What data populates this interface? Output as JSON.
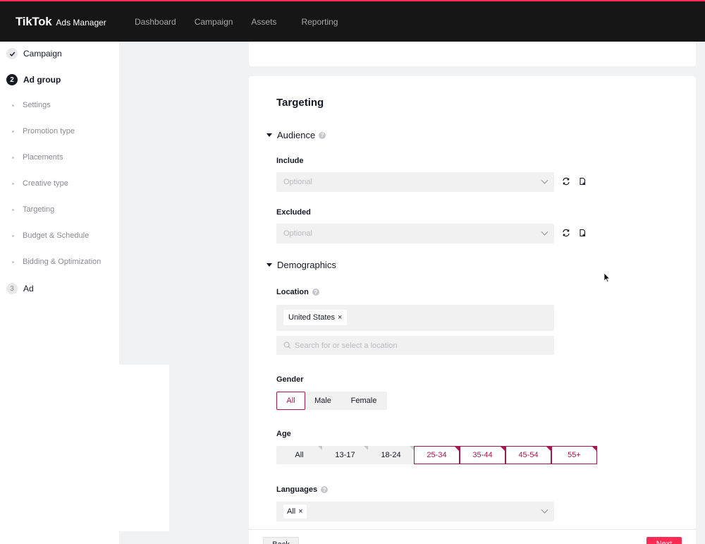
{
  "header": {
    "brand": "TikTok",
    "product": "Ads Manager",
    "nav": [
      "Dashboard",
      "Campaign",
      "Assets",
      "Reporting"
    ]
  },
  "sidebar": {
    "steps": [
      {
        "num": "✓",
        "label": "Campaign"
      },
      {
        "num": "2",
        "label": "Ad group"
      },
      {
        "num": "3",
        "label": "Ad"
      }
    ],
    "subitems": [
      "Settings",
      "Promotion type",
      "Placements",
      "Creative type",
      "Targeting",
      "Budget & Schedule",
      "Bidding & Optimization"
    ]
  },
  "targeting": {
    "title": "Targeting",
    "audience": {
      "heading": "Audience",
      "include_label": "Include",
      "include_placeholder": "Optional",
      "exclude_label": "Excluded",
      "exclude_placeholder": "Optional"
    },
    "demographics": {
      "heading": "Demographics",
      "location_label": "Location",
      "location_tag": "United States",
      "location_placeholder": "Search for or select a location",
      "gender_label": "Gender",
      "gender_options": [
        "All",
        "Male",
        "Female"
      ],
      "gender_selected": "All",
      "age_label": "Age",
      "age_options": [
        "All",
        "13-17",
        "18-24",
        "25-34",
        "35-44",
        "45-54",
        "55+"
      ],
      "age_selected": [
        "25-34",
        "35-44",
        "45-54",
        "55+"
      ],
      "languages_label": "Languages",
      "languages_tag": "All"
    }
  },
  "footer": {
    "back_label": "Back",
    "next_label": "Next"
  },
  "colors": {
    "accent": "#fe2c55",
    "selected": "#a4174f",
    "header_bg": "#161616"
  }
}
